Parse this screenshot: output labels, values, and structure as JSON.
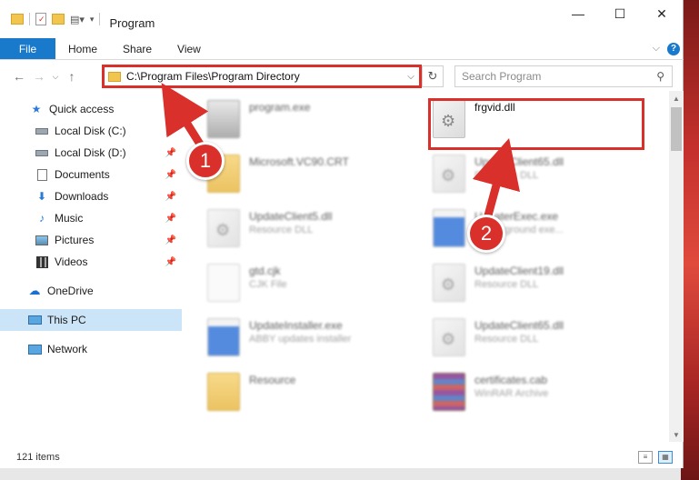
{
  "window": {
    "title": "Program"
  },
  "ribbon": {
    "file": "File",
    "tabs": [
      "Home",
      "Share",
      "View"
    ],
    "help": "?"
  },
  "address": {
    "path": "C:\\Program Files\\Program Directory"
  },
  "search": {
    "placeholder": "Search Program"
  },
  "nav": {
    "items": [
      {
        "label": "Quick access"
      },
      {
        "label": "Local Disk (C:)"
      },
      {
        "label": "Local Disk (D:)"
      },
      {
        "label": "Documents"
      },
      {
        "label": "Downloads"
      },
      {
        "label": "Music"
      },
      {
        "label": "Pictures"
      },
      {
        "label": "Videos"
      },
      {
        "label": "OneDrive"
      },
      {
        "label": "This PC"
      },
      {
        "label": "Network"
      }
    ]
  },
  "files": [
    {
      "name": "program.exe",
      "desc": ""
    },
    {
      "name": "frgvid.dll",
      "desc": ""
    },
    {
      "name": "Microsoft.VC90.CRT",
      "desc": ""
    },
    {
      "name": "UpdateClient65.dll",
      "desc": "Resource DLL"
    },
    {
      "name": "UpdateClient5.dll",
      "desc": "Resource DLL"
    },
    {
      "name": "UpdaterExec.exe",
      "desc": "Y background exe..."
    },
    {
      "name": "gtd.cjk",
      "desc": "CJK File"
    },
    {
      "name": "UpdateClient19.dll",
      "desc": "Resource DLL"
    },
    {
      "name": "UpdateInstaller.exe",
      "desc": "ABBY updates installer"
    },
    {
      "name": "UpdateClient65.dll",
      "desc": "Resource DLL"
    },
    {
      "name": "Resource",
      "desc": ""
    },
    {
      "name": "certificates.cab",
      "desc": "WinRAR Archive"
    }
  ],
  "status": {
    "count": "121 items"
  },
  "annotations": {
    "step1": "1",
    "step2": "2"
  },
  "colors": {
    "accent": "#1979ca",
    "highlight": "#d9302b",
    "selected": "#cce4f7"
  }
}
